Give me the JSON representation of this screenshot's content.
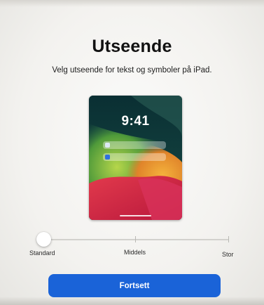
{
  "header": {
    "title": "Utseende",
    "subtitle": "Velg utseende for tekst og symboler på iPad."
  },
  "preview": {
    "time": "9:41",
    "accent_color": "#2f6fe0"
  },
  "size_slider": {
    "labels": [
      "Standard",
      "Middels",
      "Stor"
    ],
    "selected": "Standard",
    "selected_index": 0
  },
  "footer": {
    "continue_label": "Fortsett",
    "button_color": "#1a63d8"
  }
}
